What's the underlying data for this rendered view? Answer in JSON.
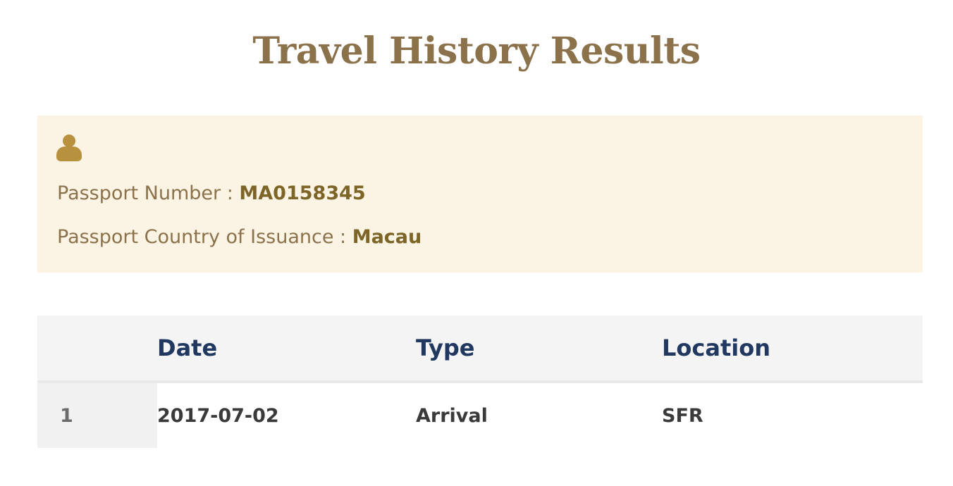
{
  "page": {
    "title": "Travel History Results"
  },
  "passport": {
    "icon": "person-icon",
    "icon_color": "#b8913e",
    "number_label": "Passport Number : ",
    "number_value": "MA0158345",
    "country_label": "Passport Country of Issuance : ",
    "country_value": "Macau"
  },
  "table": {
    "columns": [
      "",
      "Date",
      "Type",
      "Location"
    ],
    "rows": [
      {
        "index": "1",
        "date": "2017-07-02",
        "type": "Arrival",
        "location": "SFR"
      }
    ]
  },
  "colors": {
    "title": "#8b724b",
    "panel_background": "#fbf3e4",
    "header_text": "#213860"
  }
}
